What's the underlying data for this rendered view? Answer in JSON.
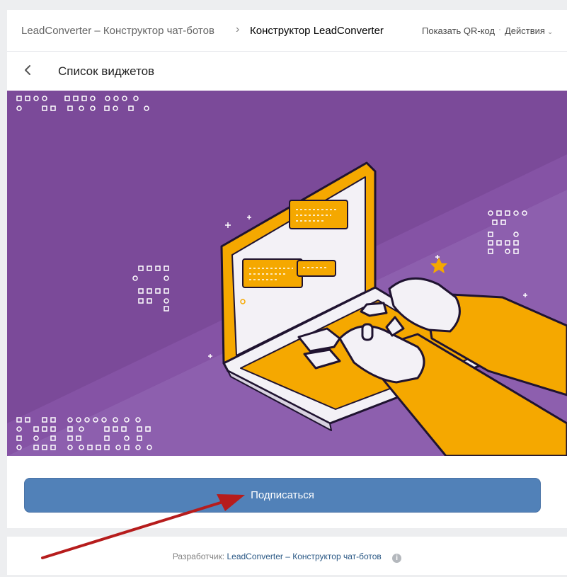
{
  "header": {
    "app_title": "LeadConverter – Конструктор чат-ботов",
    "separator": "›",
    "current_page": "Конструктор LeadConverter",
    "qr_link": "Показать QR-код",
    "dot": "·",
    "actions_label": "Действия",
    "actions_chevron": "⌄"
  },
  "subheader": {
    "title": "Список виджетов",
    "back_icon": "chevron-left-icon"
  },
  "banner": {
    "image": "robot-hands-typing-on-laptop-illustration",
    "colors": {
      "background": "#7b4a99",
      "accent": "#f5a800",
      "light": "#f3f1f6"
    }
  },
  "subscribe_button": {
    "label": "Подписаться",
    "color": "#5181b8"
  },
  "footer": {
    "developer_prefix": "Разработчик:",
    "developer_link": "LeadConverter – Конструктор чат-ботов",
    "info_icon": "info-icon",
    "info_glyph": "i"
  },
  "annotation": {
    "arrow_color": "#b61c1c"
  }
}
